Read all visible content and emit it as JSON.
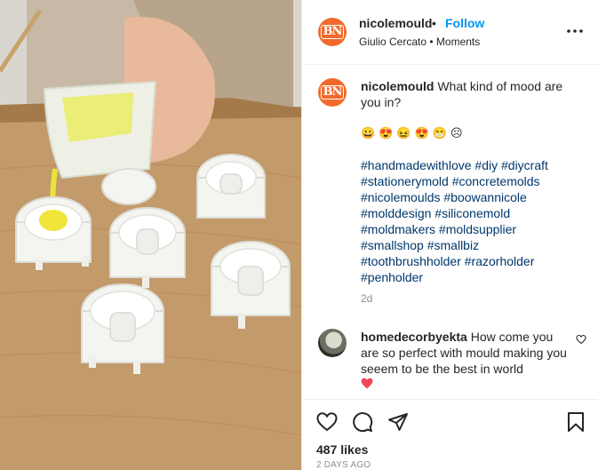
{
  "colors": {
    "accent": "#0095f6",
    "avatar_bg": "#f26a2b",
    "hashtag": "#00376b",
    "muted": "#8e8e8e",
    "like_red": "#ed4956"
  },
  "media": {
    "description_icon": "photo-media"
  },
  "header": {
    "avatar_monogram": "BN",
    "username": "nicolemould",
    "separator": "•",
    "follow_label": "Follow",
    "subtitle": "Giulio Cercato • Moments",
    "more_icon": "more-horizontal-icon"
  },
  "caption": {
    "avatar_monogram": "BN",
    "username": "nicolemould",
    "text": "What kind of mood are you in?",
    "emojis": [
      "😀",
      "😍",
      "😖",
      "😍",
      "😁",
      "☹"
    ],
    "hashtag_lines": [
      [
        "#handmadewithlove",
        "#diy",
        "#diycraft"
      ],
      [
        "#stationerymold",
        "#concretemolds"
      ],
      [
        "#nicolemoulds",
        "#boowannicole"
      ],
      [
        "#molddesign",
        "#siliconemold"
      ],
      [
        "#moldmakers",
        "#moldsupplier"
      ],
      [
        "#smallshop",
        "#smallbiz"
      ],
      [
        "#toothbrushholder",
        "#razorholder"
      ],
      [
        "#penholder"
      ]
    ],
    "time": "2d"
  },
  "comment": {
    "username": "homedecorbyekta",
    "text": "How come you are so perfect with mould making you seeem to be the best in world",
    "heart_emoji": "❤"
  },
  "actions": {
    "like_icon": "heart-icon",
    "comment_icon": "comment-icon",
    "share_icon": "share-icon",
    "save_icon": "bookmark-icon",
    "likes": "487 likes",
    "posted": "2 DAYS AGO"
  }
}
